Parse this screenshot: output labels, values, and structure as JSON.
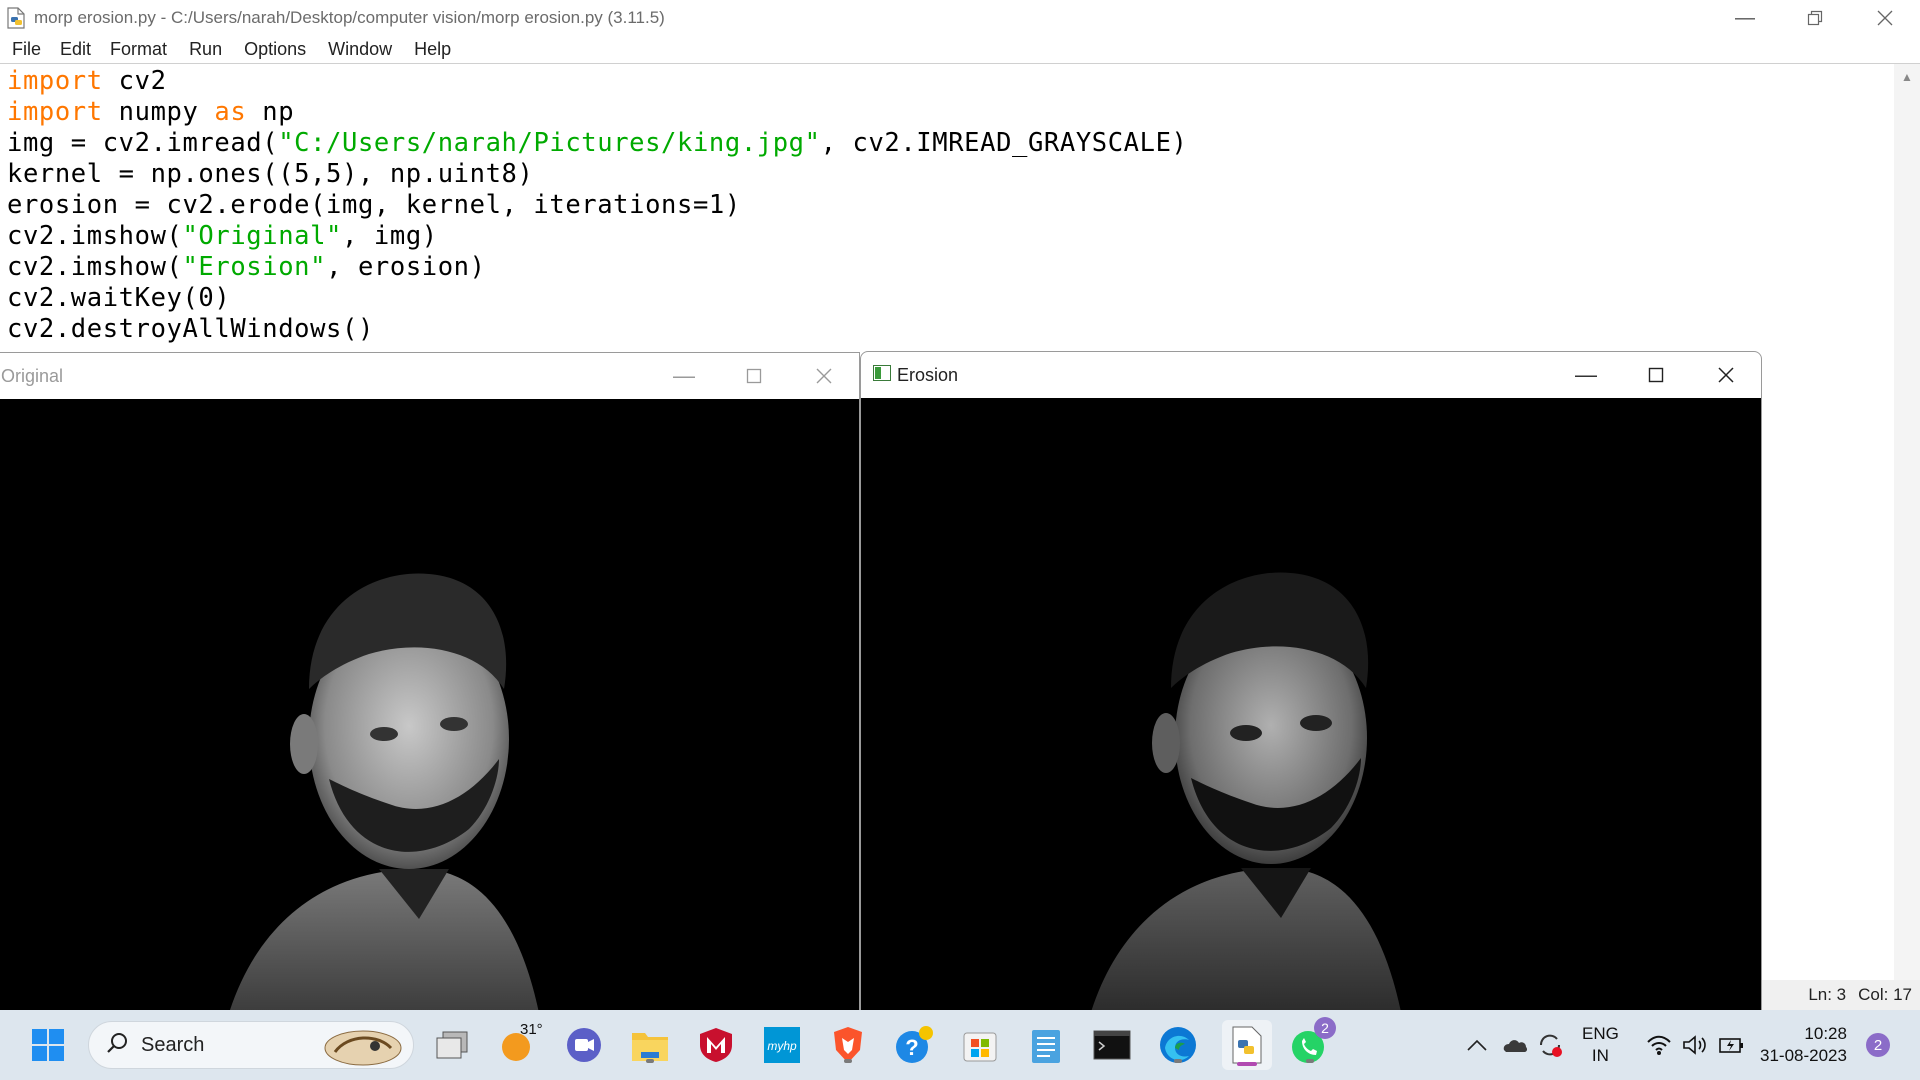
{
  "idle": {
    "title": "morp erosion.py - C:/Users/narah/Desktop/computer vision/morp erosion.py (3.11.5)",
    "menu": [
      "File",
      "Edit",
      "Format",
      "Run",
      "Options",
      "Window",
      "Help"
    ],
    "status": {
      "line": "Ln: 3",
      "col": "Col: 17"
    }
  },
  "code_lines": [
    "import cv2",
    "import numpy as np",
    "img = cv2.imread(\"C:/Users/narah/Pictures/king.jpg\", cv2.IMREAD_GRAYSCALE)",
    "kernel = np.ones((5,5), np.uint8)",
    "erosion = cv2.erode(img, kernel, iterations=1)",
    "cv2.imshow(\"Original\", img)",
    "cv2.imshow(\"Erosion\", erosion)",
    "cv2.waitKey(0)",
    "cv2.destroyAllWindows()"
  ],
  "windows": {
    "original": {
      "title": "Original"
    },
    "erosion": {
      "title": "Erosion"
    }
  },
  "taskbar": {
    "search_label": "Search",
    "weather_temp": "31°",
    "whatsapp_badge": "2",
    "lang_top": "ENG",
    "lang_bottom": "IN",
    "time": "10:28",
    "date": "31-08-2023",
    "notification_count": "2",
    "icons": [
      "start-icon",
      "search-icon",
      "task-view-icon",
      "weather-icon",
      "teams-icon",
      "file-explorer-icon",
      "mcafee-icon",
      "myhp-icon",
      "brave-icon",
      "help-icon",
      "store-icon",
      "notepad-icon",
      "terminal-icon",
      "edge-icon",
      "python-idle-icon",
      "whatsapp-icon"
    ]
  }
}
